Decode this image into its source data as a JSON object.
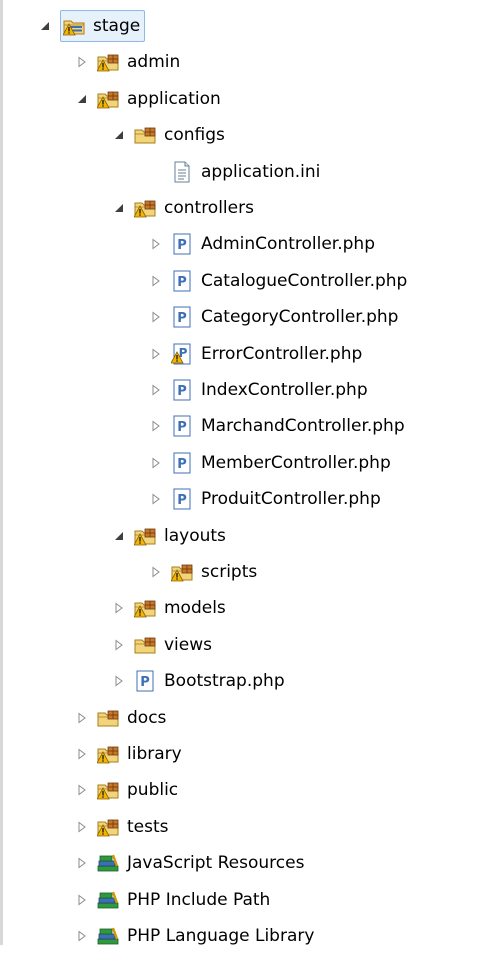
{
  "tree": [
    {
      "name": "node-stage",
      "label": "stage",
      "icon": "project-folder-warning-icon",
      "toggle": "expanded",
      "level": 0
    },
    {
      "name": "node-admin",
      "label": "admin",
      "icon": "package-folder-warning-icon",
      "toggle": "collapsed",
      "level": 1
    },
    {
      "name": "node-application",
      "label": "application",
      "icon": "package-folder-warning-icon",
      "toggle": "expanded",
      "level": 1
    },
    {
      "name": "node-configs",
      "label": "configs",
      "icon": "package-folder-icon",
      "toggle": "expanded",
      "level": 2
    },
    {
      "name": "node-application-ini",
      "label": "application.ini",
      "icon": "text-file-icon",
      "toggle": "none",
      "level": 3
    },
    {
      "name": "node-controllers",
      "label": "controllers",
      "icon": "package-folder-warning-icon",
      "toggle": "expanded",
      "level": 2
    },
    {
      "name": "node-admincontroller",
      "label": "AdminController.php",
      "icon": "php-file-icon",
      "toggle": "collapsed",
      "level": 3
    },
    {
      "name": "node-cataloguecontroller",
      "label": "CatalogueController.php",
      "icon": "php-file-icon",
      "toggle": "collapsed",
      "level": 3
    },
    {
      "name": "node-categorycontroller",
      "label": "CategoryController.php",
      "icon": "php-file-icon",
      "toggle": "collapsed",
      "level": 3
    },
    {
      "name": "node-errorcontroller",
      "label": "ErrorController.php",
      "icon": "php-file-warning-icon",
      "toggle": "collapsed",
      "level": 3
    },
    {
      "name": "node-indexcontroller",
      "label": "IndexController.php",
      "icon": "php-file-icon",
      "toggle": "collapsed",
      "level": 3
    },
    {
      "name": "node-marchandcontroller",
      "label": "MarchandController.php",
      "icon": "php-file-icon",
      "toggle": "collapsed",
      "level": 3
    },
    {
      "name": "node-membercontroller",
      "label": "MemberController.php",
      "icon": "php-file-icon",
      "toggle": "collapsed",
      "level": 3
    },
    {
      "name": "node-produitcontroller",
      "label": "ProduitController.php",
      "icon": "php-file-icon",
      "toggle": "collapsed",
      "level": 3
    },
    {
      "name": "node-layouts",
      "label": "layouts",
      "icon": "package-folder-warning-icon",
      "toggle": "expanded",
      "level": 2
    },
    {
      "name": "node-scripts",
      "label": "scripts",
      "icon": "package-folder-warning-icon",
      "toggle": "collapsed",
      "level": 3
    },
    {
      "name": "node-models",
      "label": "models",
      "icon": "package-folder-warning-icon",
      "toggle": "collapsed",
      "level": 2
    },
    {
      "name": "node-views",
      "label": "views",
      "icon": "package-folder-icon",
      "toggle": "collapsed",
      "level": 2
    },
    {
      "name": "node-bootstrap",
      "label": "Bootstrap.php",
      "icon": "php-file-icon",
      "toggle": "collapsed",
      "level": 2
    },
    {
      "name": "node-docs",
      "label": "docs",
      "icon": "package-folder-icon",
      "toggle": "collapsed",
      "level": 1
    },
    {
      "name": "node-library",
      "label": "library",
      "icon": "package-folder-warning-icon",
      "toggle": "collapsed",
      "level": 1
    },
    {
      "name": "node-public",
      "label": "public",
      "icon": "package-folder-warning-icon",
      "toggle": "collapsed",
      "level": 1
    },
    {
      "name": "node-tests",
      "label": "tests",
      "icon": "package-folder-warning-icon",
      "toggle": "collapsed",
      "level": 1
    },
    {
      "name": "node-javascript-resources",
      "label": "JavaScript Resources",
      "icon": "library-books-icon",
      "toggle": "collapsed",
      "level": 1
    },
    {
      "name": "node-php-include-path",
      "label": "PHP Include Path",
      "icon": "library-books-icon",
      "toggle": "collapsed",
      "level": 1
    },
    {
      "name": "node-php-language-library",
      "label": "PHP Language Library",
      "icon": "library-books-icon",
      "toggle": "collapsed",
      "level": 1
    }
  ],
  "colors": {
    "selection_bg": "#e7f1fc",
    "selection_border": "#8fb8e6",
    "folder": "#f2d57a",
    "php_blue": "#3d6fb6",
    "warning": "#f4b400"
  }
}
